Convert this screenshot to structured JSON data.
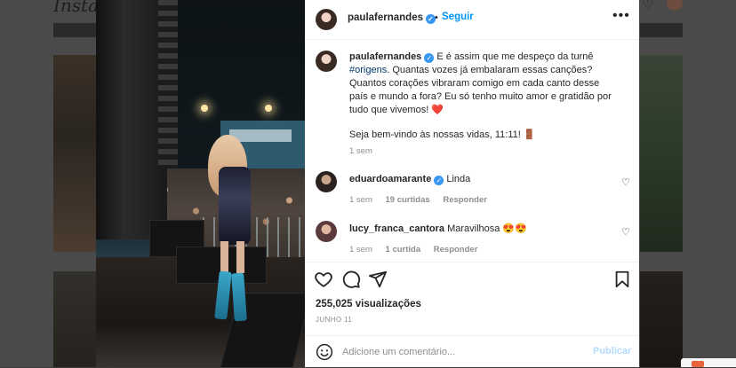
{
  "background": {
    "logo_text": "Instag"
  },
  "post": {
    "username": "paulafernandes",
    "follow_label": "Seguir",
    "separator": "•",
    "more_label": "•••",
    "caption": {
      "username": "paulafernandes",
      "text_before_hashtag": "E é assim que me despeço da turnê",
      "hashtag": "#origens",
      "text_after_hashtag": ". Quantas vozes já embalaram essas canções? Quantos corações vibraram comigo em cada canto desse país e mundo a fora? Eu só tenho muito amor e gratidão por tudo que vivemos! ❤️",
      "paragraph2": "Seja bem-vindo às nossas vidas, 11:11! 🚪",
      "time": "1 sem"
    },
    "comments": [
      {
        "username": "eduardoamarante",
        "text": "Linda",
        "time": "1 sem",
        "likes": "19 curtidas",
        "reply": "Responder"
      },
      {
        "username": "lucy_franca_cantora",
        "text": "Maravilhosa 😍😍",
        "time": "1 sem",
        "likes": "1 curtida",
        "reply": "Responder"
      }
    ],
    "views": "255,025 visualizações",
    "date": "JUNHO 11",
    "add_comment": {
      "placeholder": "Adicione um comentário...",
      "publish_label": "Publicar"
    }
  },
  "icons": {
    "like": "heart-icon",
    "comment": "comment-icon",
    "share": "send-icon",
    "save": "bookmark-icon",
    "emoji": "smiley-icon",
    "verified": "verified-badge-icon"
  },
  "colors": {
    "link_blue": "#0095f6",
    "verified_blue": "#3897f0",
    "publish_disabled": "#b3dbff",
    "text": "#262626",
    "muted": "#8e8e8e"
  }
}
